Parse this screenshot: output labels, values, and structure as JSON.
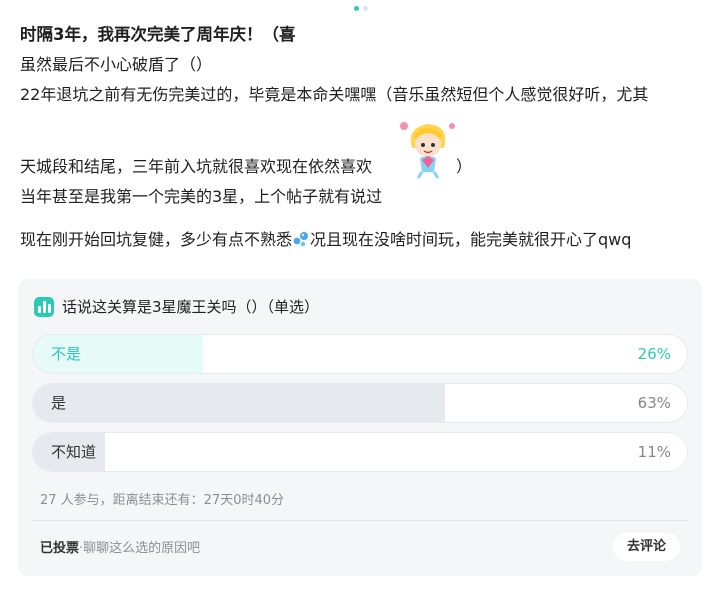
{
  "post": {
    "title": "时隔3年，我再次完美了周年庆！（喜",
    "lines": [
      "虽然最后不小心破盾了（）",
      "22年退坑之前有无伤完美过的，毕竟是本命关嘿嘿（音乐虽然短但个人感觉很好听，尤其",
      "天城段和结尾，三年前入坑就很喜欢现在依然喜欢",
      "）",
      "当年甚至是我第一个完美的3星，上个帖子就有说过",
      "现在刚开始回坑复健，多少有点不熟悉",
      "况且现在没啥时间玩，能完美就很开心了qwq"
    ],
    "sticker_icon": "anime-girl-sticker-icon",
    "emoji_icon": "water-drops-emoji-icon"
  },
  "poll": {
    "question": "话说这关算是3星魔王关吗（）（单选）",
    "accent": "#2cc9b6",
    "options": [
      {
        "label": "不是",
        "percent": "26%",
        "fraction": 0.26,
        "selected": true
      },
      {
        "label": "是",
        "percent": "63%",
        "fraction": 0.63,
        "selected": false
      },
      {
        "label": "不知道",
        "percent": "11%",
        "fraction": 0.11,
        "selected": false
      }
    ],
    "stats": "27 人参与，距离结束还有：27天0时40分",
    "voted_label": "已投票",
    "hint": "·聊聊这么选的原因吧",
    "comment_button": "去评论"
  }
}
